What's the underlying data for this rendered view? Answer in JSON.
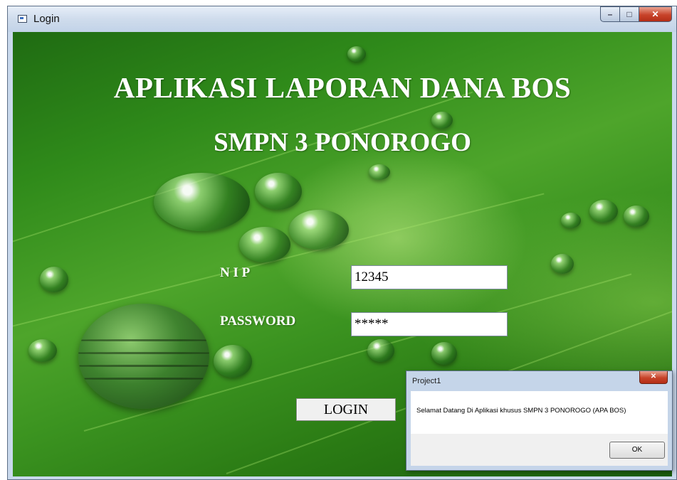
{
  "window": {
    "title": "Login",
    "controls": {
      "minimize": "–",
      "maximize": "□",
      "close": "✕"
    }
  },
  "form": {
    "heading_line1": "APLIKASI LAPORAN DANA BOS",
    "heading_line2": "SMPN 3 PONOROGO",
    "nip_label": "N I P",
    "nip_value": "12345",
    "password_label": "PASSWORD",
    "password_value": "*****",
    "login_button": "LOGIN"
  },
  "dialog": {
    "title": "Project1",
    "close": "✕",
    "message": "Selamat Datang Di Aplikasi khusus SMPN 3 PONOROGO (APA BOS)",
    "ok_button": "OK"
  },
  "colors": {
    "leaf_green": "#3b9320",
    "close_red": "#c7432a",
    "titlebar": "#cfdcec"
  }
}
